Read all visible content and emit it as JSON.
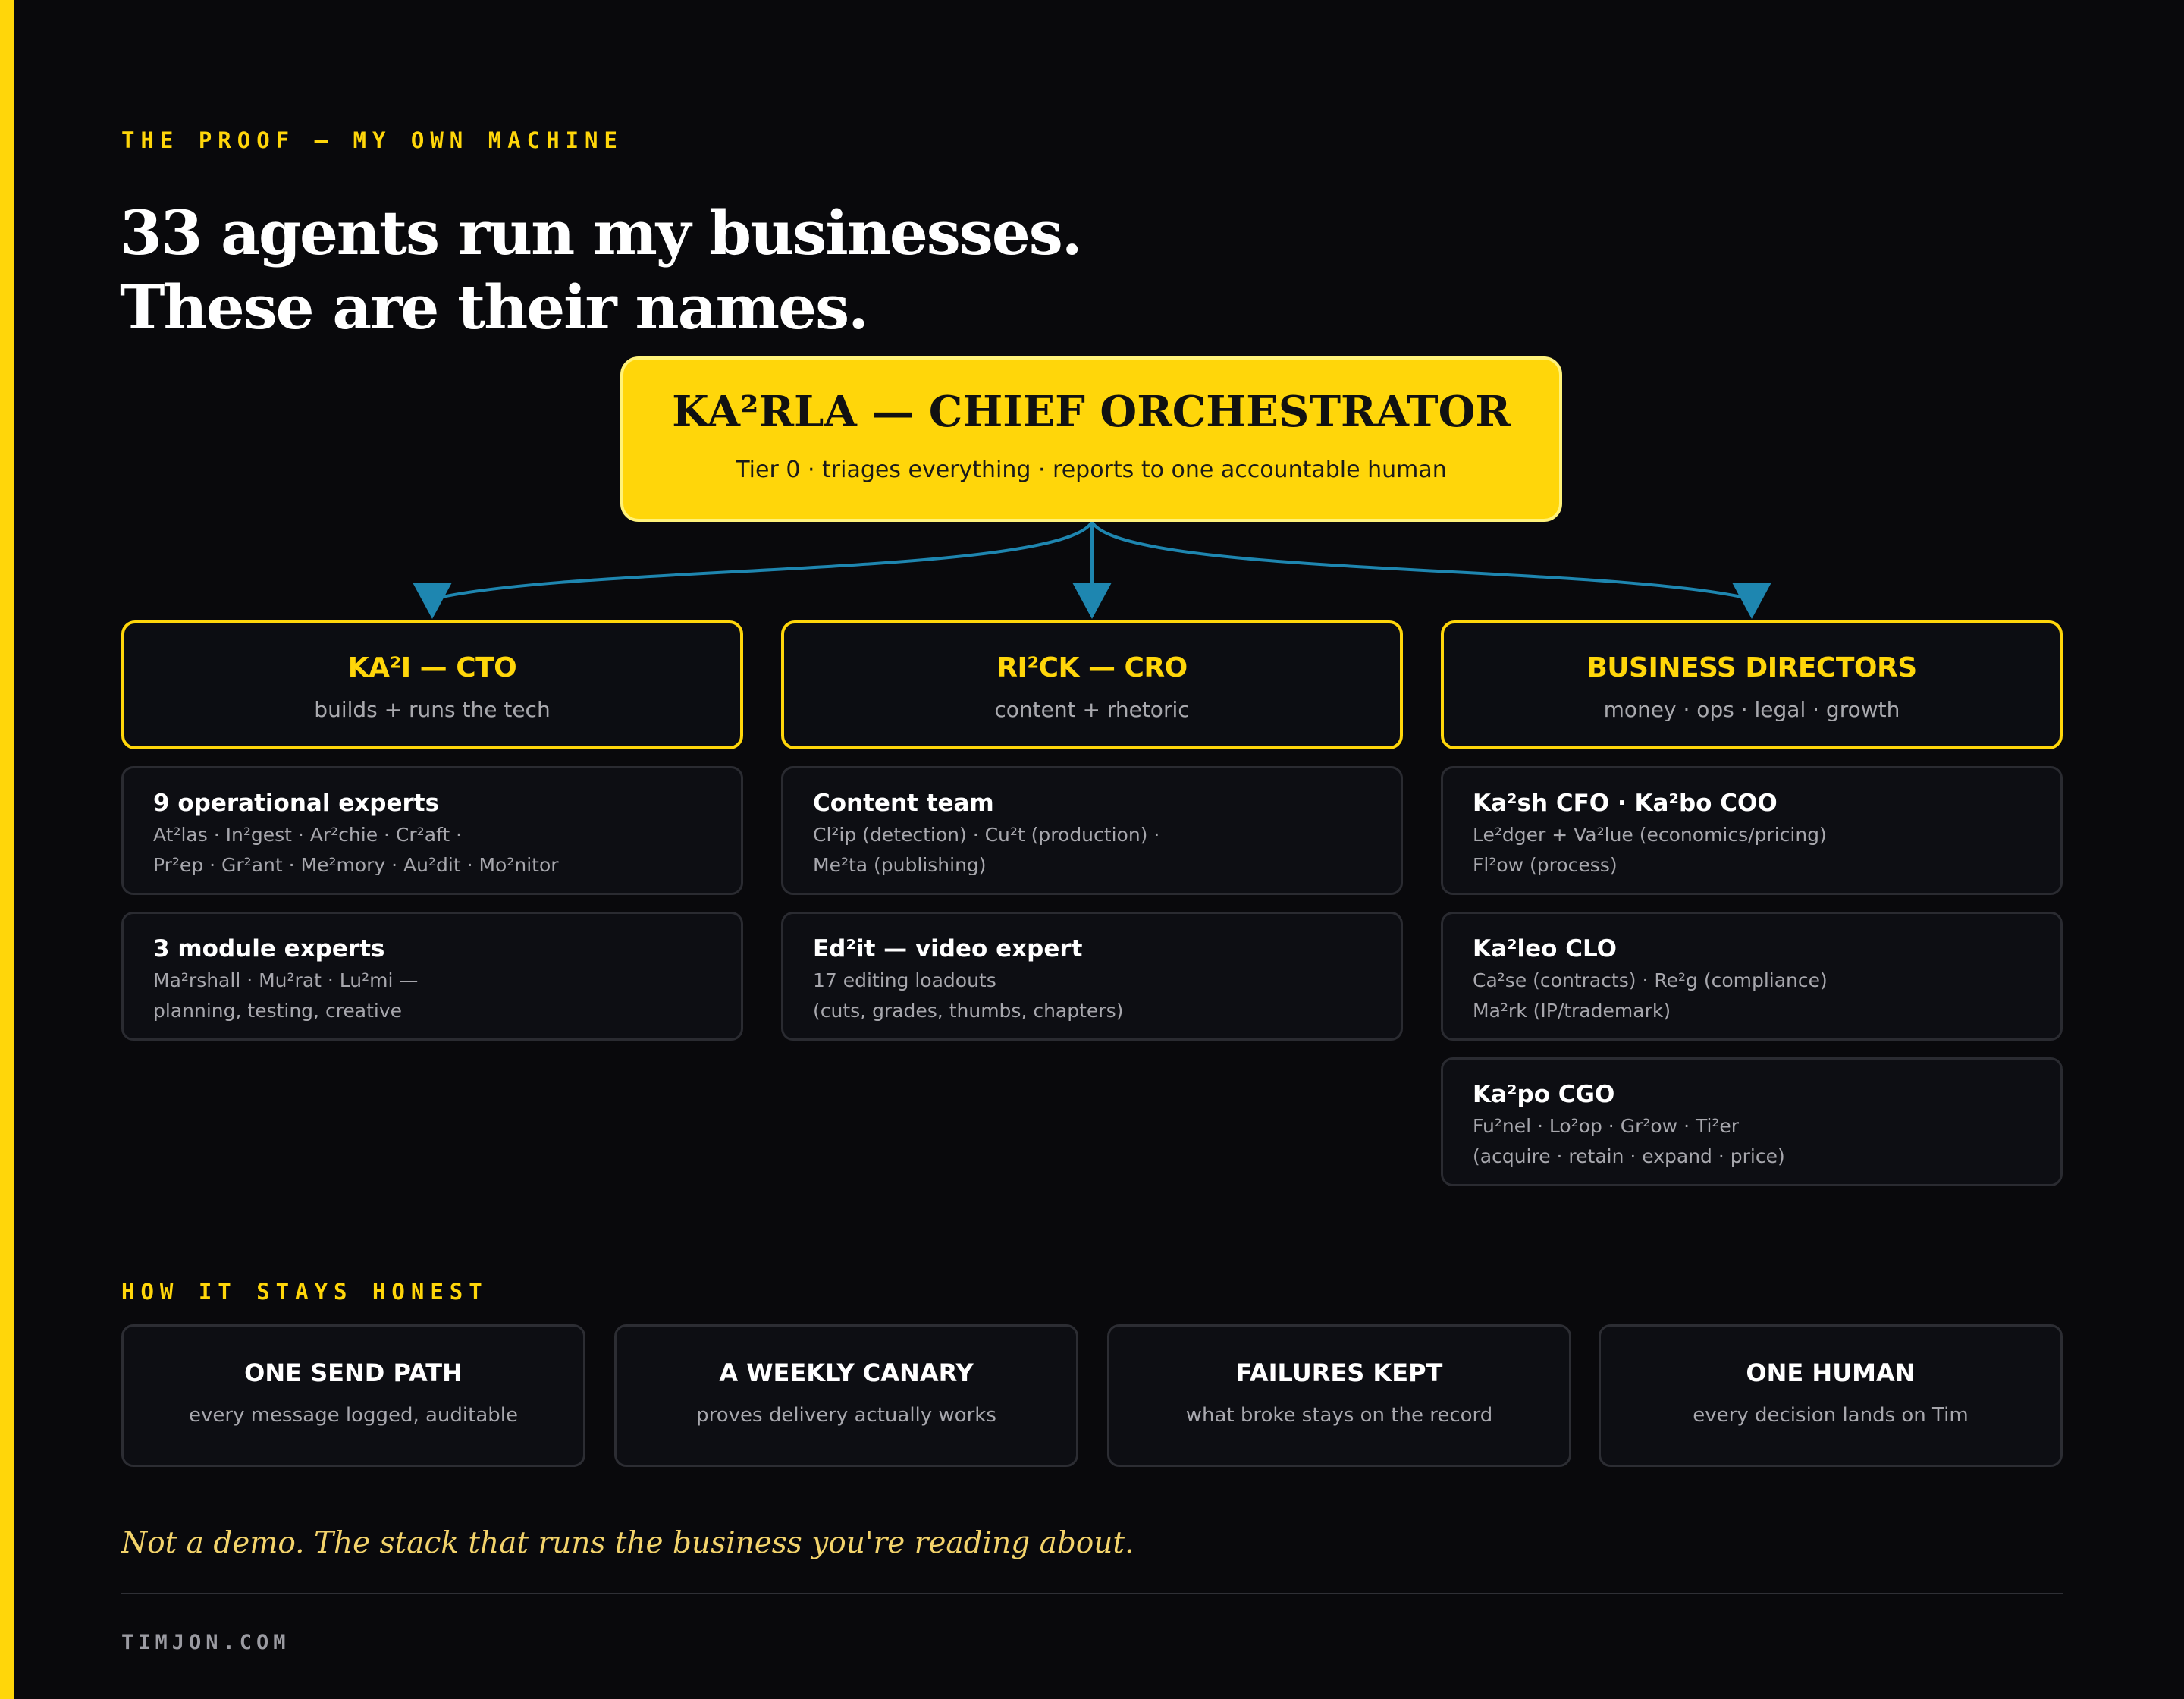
{
  "eyebrow": "THE PROOF — MY OWN MACHINE",
  "headline": {
    "line1": "33 agents run my businesses.",
    "line2": "These are their names."
  },
  "root": {
    "title": "KA²RLA — CHIEF ORCHESTRATOR",
    "subtitle": "Tier 0 · triages everything · reports to one accountable human"
  },
  "colors": {
    "accent": "#ffd60a",
    "connector": "#1e86b0",
    "background": "#09090c"
  },
  "lanes": [
    {
      "title": "KA²I — CTO",
      "subtitle": "builds + runs the tech",
      "cards": [
        {
          "title": "9 operational experts",
          "line1": "At²las · In²gest · Ar²chie · Cr²aft ·",
          "line2": "Pr²ep · Gr²ant · Me²mory · Au²dit · Mo²nitor"
        },
        {
          "title": "3 module experts",
          "line1": "Ma²rshall · Mu²rat · Lu²mi —",
          "line2": "planning, testing, creative"
        }
      ]
    },
    {
      "title": "RI²CK — CRO",
      "subtitle": "content + rhetoric",
      "cards": [
        {
          "title": "Content team",
          "line1": "Cl²ip (detection) · Cu²t (production) ·",
          "line2": "Me²ta (publishing)"
        },
        {
          "title": "Ed²it — video expert",
          "line1": "17 editing loadouts",
          "line2": "(cuts, grades, thumbs, chapters)"
        }
      ]
    },
    {
      "title": "BUSINESS DIRECTORS",
      "subtitle": "money · ops · legal · growth",
      "cards": [
        {
          "title": "Ka²sh CFO · Ka²bo COO",
          "line1": "Le²dger + Va²lue (economics/pricing)",
          "line2": "Fl²ow (process)"
        },
        {
          "title": "Ka²leo CLO",
          "line1": "Ca²se (contracts) · Re²g (compliance)",
          "line2": "Ma²rk (IP/trademark)"
        },
        {
          "title": "Ka²po CGO",
          "line1": "Fu²nel · Lo²op · Gr²ow · Ti²er",
          "line2": "(acquire · retain · expand · price)"
        }
      ]
    }
  ],
  "honest": {
    "label": "HOW IT STAYS HONEST",
    "items": [
      {
        "title": "ONE SEND PATH",
        "subtitle": "every message logged, auditable"
      },
      {
        "title": "A WEEKLY CANARY",
        "subtitle": "proves delivery actually works"
      },
      {
        "title": "FAILURES KEPT",
        "subtitle": "what broke stays on the record"
      },
      {
        "title": "ONE HUMAN",
        "subtitle": "every decision lands on Tim"
      }
    ]
  },
  "tagline": "Not a demo. The stack that runs the business you're reading about.",
  "footer": "TIMJON.COM"
}
